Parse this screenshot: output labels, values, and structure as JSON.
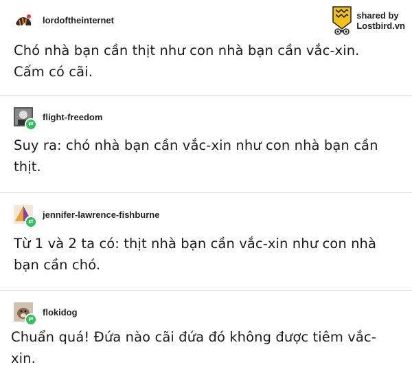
{
  "watermark": {
    "line1": "shared by",
    "line2": "Lostbird.vn"
  },
  "posts": [
    {
      "username": "lordoftheinternet",
      "avatar_icon": "tiger-avatar-icon",
      "reblog": false,
      "lines": [
        "Chó nhà bạn cần thịt như con nhà bạn cần vắc-xin.",
        "Cấm có cãi."
      ]
    },
    {
      "username": "flight-freedom",
      "avatar_icon": "photo-avatar-icon",
      "reblog": true,
      "lines": [
        "Suy ra: chó nhà bạn cần vắc-xin như con nhà bạn cần",
        "thịt."
      ]
    },
    {
      "username": "jennifer-lawrence-fishburne",
      "avatar_icon": "pyramid-avatar-icon",
      "reblog": true,
      "lines": [
        "Từ 1 và 2 ta có: thịt nhà bạn cần vắc-xin như con nhà",
        "bạn cần chó."
      ]
    },
    {
      "username": "flokidog",
      "avatar_icon": "dog-avatar-icon",
      "reblog": true,
      "lines": [
        "Chuẩn quá! Đứa nào cãi đứa đó không được tiêm vắc-xin."
      ]
    }
  ],
  "colors": {
    "reblog_badge": "#2ec05b",
    "divider": "#d9d9d9",
    "watermark_logo": "#f2c21b"
  }
}
